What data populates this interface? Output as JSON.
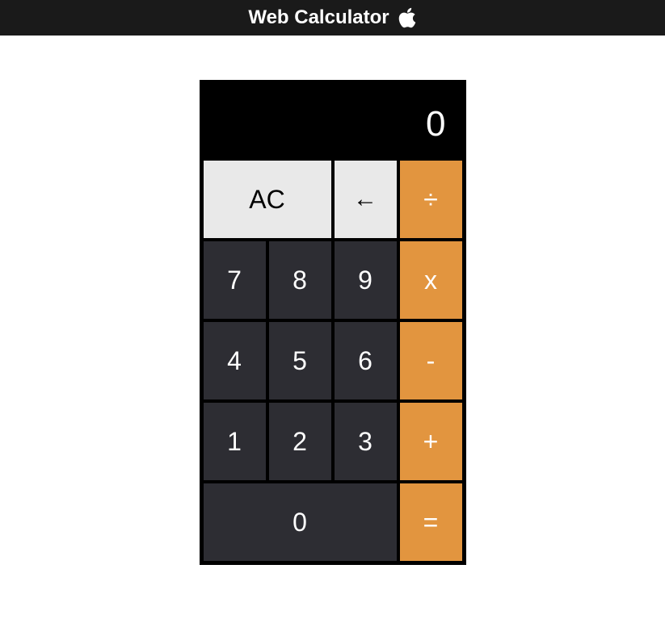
{
  "header": {
    "title": "Web Calculator"
  },
  "display": {
    "value": "0"
  },
  "buttons": {
    "clear": "AC",
    "back": "←",
    "divide": "÷",
    "seven": "7",
    "eight": "8",
    "nine": "9",
    "multiply": "x",
    "four": "4",
    "five": "5",
    "six": "6",
    "subtract": "-",
    "one": "1",
    "two": "2",
    "three": "3",
    "add": "+",
    "zero": "0",
    "equals": "="
  }
}
